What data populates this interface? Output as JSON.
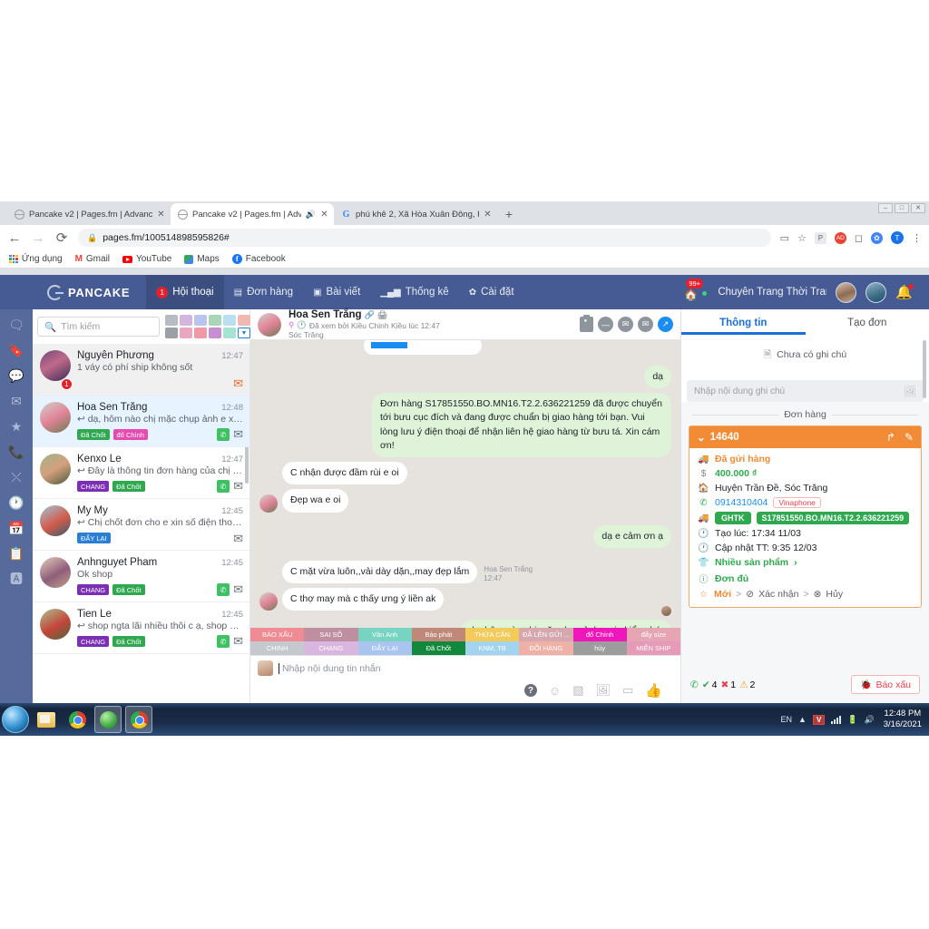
{
  "browser": {
    "tabs": [
      {
        "title": "Pancake v2 | Pages.fm | Advance",
        "icon": "globe-icon",
        "active": false,
        "muted": false
      },
      {
        "title": "Pancake v2 | Pages.fm | Adva",
        "icon": "globe-icon",
        "active": true,
        "muted": true
      },
      {
        "title": "phú khê 2, Xã Hòa Xuân Đông, H",
        "icon": "google-icon",
        "active": false,
        "muted": false
      }
    ],
    "new_tab_label": "+",
    "window_controls": [
      "–",
      "□",
      "✕"
    ],
    "nav": {
      "back": "←",
      "forward": "→",
      "reload": "⟳"
    },
    "omnibox": {
      "url": "pages.fm/100514898595826#",
      "lock": "lock-icon"
    },
    "toolbar_icons": [
      "video-icon",
      "star-icon",
      "extension-p",
      "extension-red",
      "extension-blue",
      "profile-t"
    ],
    "bookmarks": [
      {
        "label": "Ứng dụng",
        "icon": "apps-grid-icon"
      },
      {
        "label": "Gmail",
        "icon": "gmail-icon"
      },
      {
        "label": "YouTube",
        "icon": "youtube-icon"
      },
      {
        "label": "Maps",
        "icon": "maps-icon"
      },
      {
        "label": "Facebook",
        "icon": "facebook-icon"
      }
    ]
  },
  "appbar": {
    "logo": "PANCAKE",
    "nav": [
      {
        "label": "Hội thoại",
        "badge": "1",
        "icon": "chat-icon",
        "active": true
      },
      {
        "label": "Đơn hàng",
        "icon": "order-icon",
        "active": false
      },
      {
        "label": "Bài viết",
        "icon": "post-icon",
        "active": false
      },
      {
        "label": "Thống kê",
        "icon": "stats-icon",
        "active": false
      },
      {
        "label": "Cài đặt",
        "icon": "gear-icon",
        "active": false
      }
    ],
    "shop_badge": "99+",
    "page_name": "Chuyên Trang Thời Tran...",
    "bell": "bell-icon"
  },
  "rail": {
    "items": [
      {
        "icon": "chats-icon"
      },
      {
        "icon": "bookmark-icon"
      },
      {
        "icon": "comment-icon"
      },
      {
        "icon": "envelope-icon"
      },
      {
        "icon": "star-icon"
      },
      {
        "icon": "phone-icon"
      },
      {
        "icon": "export-icon"
      },
      {
        "icon": "clock-icon"
      },
      {
        "icon": "calendar-icon"
      },
      {
        "icon": "list-icon"
      },
      {
        "icon": "ads-a-icon"
      }
    ]
  },
  "conversations": {
    "search_placeholder": "Tìm kiếm",
    "swatches_row1": [
      "#b7bcc4",
      "#d3b6de",
      "#b9c4ef",
      "#a9d6b6",
      "#b9dff0",
      "#f0b8b0"
    ],
    "swatches_row2": [
      "#9aa0a6",
      "#e8a8c0",
      "#ef9aa6",
      "#c58fd0",
      "#a6e3d4",
      "#ffffff"
    ],
    "items": [
      {
        "name": "Nguyên Phương",
        "time": "12:47",
        "snippet": "1 váy có phí ship không sốt",
        "tags": [],
        "unread_count": "1",
        "has_phone": false,
        "mail_state": "orange",
        "state": "unread",
        "avatar": "avatar-1"
      },
      {
        "name": "Hoa Sen Trắng",
        "time": "12:48",
        "snippet": "↩ dạ, hôm nào chị mặc chụp ảnh e xi...",
        "tags": [
          {
            "label": "Đã Chốt",
            "color": "#2fa84f"
          },
          {
            "label": "đổ Chình",
            "color": "#e54bb0"
          }
        ],
        "unread_count": "",
        "has_phone": true,
        "mail_state": "grey",
        "state": "selected",
        "avatar": "avatar-2"
      },
      {
        "name": "Kenxo Le",
        "time": "12:47",
        "snippet": "↩ Đây là thông tin đơn hàng của chị ạ...",
        "tags": [
          {
            "label": "CHANG",
            "color": "#7b2fb5"
          },
          {
            "label": "Đã Chốt",
            "color": "#2fa84f"
          }
        ],
        "unread_count": "",
        "has_phone": true,
        "mail_state": "grey",
        "state": "normal",
        "avatar": "avatar-3"
      },
      {
        "name": "My My",
        "time": "12:45",
        "snippet": "↩ Chị chốt đơn cho e xin số điện thoạ...",
        "tags": [
          {
            "label": "ĐẨY LẠI",
            "color": "#2a7fd4"
          }
        ],
        "unread_count": "",
        "has_phone": false,
        "mail_state": "grey",
        "state": "normal",
        "avatar": "avatar-4"
      },
      {
        "name": "Anhnguyet Pham",
        "time": "12:45",
        "snippet": "Ok shop",
        "tags": [
          {
            "label": "CHANG",
            "color": "#7b2fb5"
          },
          {
            "label": "Đã Chốt",
            "color": "#2fa84f"
          }
        ],
        "unread_count": "",
        "has_phone": true,
        "mail_state": "grey",
        "state": "normal",
        "avatar": "avatar-5"
      },
      {
        "name": "Tien Le",
        "time": "12:45",
        "snippet": "↩ shop ngta lãi nhiều thôi c ạ, shop e ...",
        "tags": [
          {
            "label": "CHANG",
            "color": "#7b2fb5"
          },
          {
            "label": "Đã Chốt",
            "color": "#2fa84f"
          }
        ],
        "unread_count": "",
        "has_phone": true,
        "mail_state": "grey",
        "state": "normal",
        "avatar": "avatar-6"
      }
    ]
  },
  "chat": {
    "header": {
      "name": "Hoa Sen Trắng",
      "seen_text": "Đã xem bởi Kiều Chinh Kiều lúc 12:47",
      "location": "Sóc Trăng",
      "actions": [
        "id-card-icon",
        "minus-circle-icon",
        "mail-open-icon",
        "mail-icon",
        "arrow-expand-icon"
      ]
    },
    "messages": [
      {
        "side": "out",
        "text": "dạ"
      },
      {
        "side": "out",
        "text": "Đơn hàng S17851550.BO.MN16.T2.2.636221259 đã được chuyển tới bưu cục đích và đang được chuẩn bị giao hàng tới bạn. Vui lòng lưu ý điện thoại để nhận liên hệ giao hàng từ bưu tá. Xin cám ơn!"
      },
      {
        "side": "in",
        "text": "C nhận được đầm rùi e oi"
      },
      {
        "side": "in",
        "text": "Đẹp wa e oi",
        "show_avatar": true
      },
      {
        "side": "out",
        "text": "dạ e cảm ơn ạ"
      },
      {
        "side": "in",
        "text": "C mặt vừa luôn,,vải dày dặn,,may đẹp lắm",
        "stamp_name": "Hoa Sen Trắng",
        "stamp_time": "12:47"
      },
      {
        "side": "in",
        "text": "C thợ may mà c thấy ưng ý liền ak",
        "show_avatar": true
      },
      {
        "side": "out",
        "text": "dạ, hôm nào chị mặc chụp ảnh e xin kiểu nhé,"
      }
    ],
    "tag_strip_row1": [
      {
        "label": "BÁO XẤU",
        "color": "#ef8b92"
      },
      {
        "label": "SAI SỐ",
        "color": "#bd8fa0"
      },
      {
        "label": "Vân Anh",
        "color": "#76d4c1"
      },
      {
        "label": "Báo phát",
        "color": "#c08878"
      },
      {
        "label": "THỪA CÂN",
        "color": "#f2cb5a"
      },
      {
        "label": "ĐÃ LÊN GỬI ...",
        "color": "#d6a8ad"
      },
      {
        "label": "đổ Chình",
        "color": "#ef17b9"
      },
      {
        "label": "đẩy size",
        "color": "#e5a5b3"
      }
    ],
    "tag_strip_row2": [
      {
        "label": "CHINH",
        "color": "#c5c8cc"
      },
      {
        "label": "CHANG",
        "color": "#d9b6e0"
      },
      {
        "label": "ĐẨY LẠI",
        "color": "#a9c5ef"
      },
      {
        "label": "Đã Chốt",
        "color": "#12883c"
      },
      {
        "label": "KNM, TB",
        "color": "#a2d3ef"
      },
      {
        "label": "ĐỔI HÀNG",
        "color": "#efb0a8"
      },
      {
        "label": "hủy",
        "color": "#9c9c9c"
      },
      {
        "label": "MIỄN SHIP",
        "color": "#e59ab7"
      }
    ],
    "composer": {
      "placeholder": "Nhập nội dung tin nhắn",
      "tools": [
        "help-icon",
        "emoji-icon",
        "sticker-icon",
        "image-icon",
        "quickreply-icon",
        "like-icon"
      ]
    }
  },
  "right_panel": {
    "tabs": [
      {
        "label": "Thông tin",
        "active": true
      },
      {
        "label": "Tạo đơn",
        "active": false
      }
    ],
    "note": {
      "empty_text": "Chưa có ghi chú",
      "empty_icon": "file-icon",
      "input_placeholder": "Nhập nội dung ghi chú",
      "image_icon": "image-icon"
    },
    "orders_title": "Đơn hàng",
    "order": {
      "id": "14640",
      "chevron": "chevron-down-icon",
      "header_actions": [
        "share-icon",
        "edit-icon"
      ],
      "status": "Đã gửi hàng",
      "status_icon": "truck-icon",
      "amount": "400.000 ₫",
      "amount_icon": "dollar-icon",
      "address": "Huyện Trần Đề, Sóc Trăng",
      "address_icon": "home-icon",
      "phone": "0914310404",
      "phone_icon": "phone-icon",
      "carrier": "Vinaphone",
      "shipper": "GHTK",
      "tracking": "S17851550.BO.MN16.T2.2.636221259",
      "shipper_icon": "truck-icon",
      "created": "Tạo lúc: 17:34 11/03",
      "updated": "Cập nhật TT: 9:35 12/03",
      "products": "Nhiều sản phẩm",
      "products_icon": "shirt-icon",
      "complete": "Đơn đủ",
      "complete_icon": "info-icon",
      "steps": [
        {
          "label": "Mới",
          "icon": "star-icon",
          "active": true
        },
        {
          "label": "Xác nhận",
          "icon": "check-circle-icon",
          "active": false
        },
        {
          "label": "Hủy",
          "icon": "x-circle-icon",
          "active": false
        }
      ]
    },
    "footer": {
      "phone_icon": "phone-icon",
      "success_count": "4",
      "fail_count": "1",
      "warn_count": "2",
      "report_label": "Báo xấu",
      "report_icon": "bug-icon"
    }
  },
  "taskbar": {
    "apps": [
      "start-orb",
      "folder-icon",
      "chrome-icon",
      "green-app-icon",
      "chrome-active-icon"
    ],
    "lang": "EN",
    "tray_icons": [
      "arrow-up-icon",
      "unikey-v-icon",
      "network-icon",
      "battery-icon",
      "volume-icon"
    ],
    "time": "12:48 PM",
    "date": "3/16/2021"
  }
}
